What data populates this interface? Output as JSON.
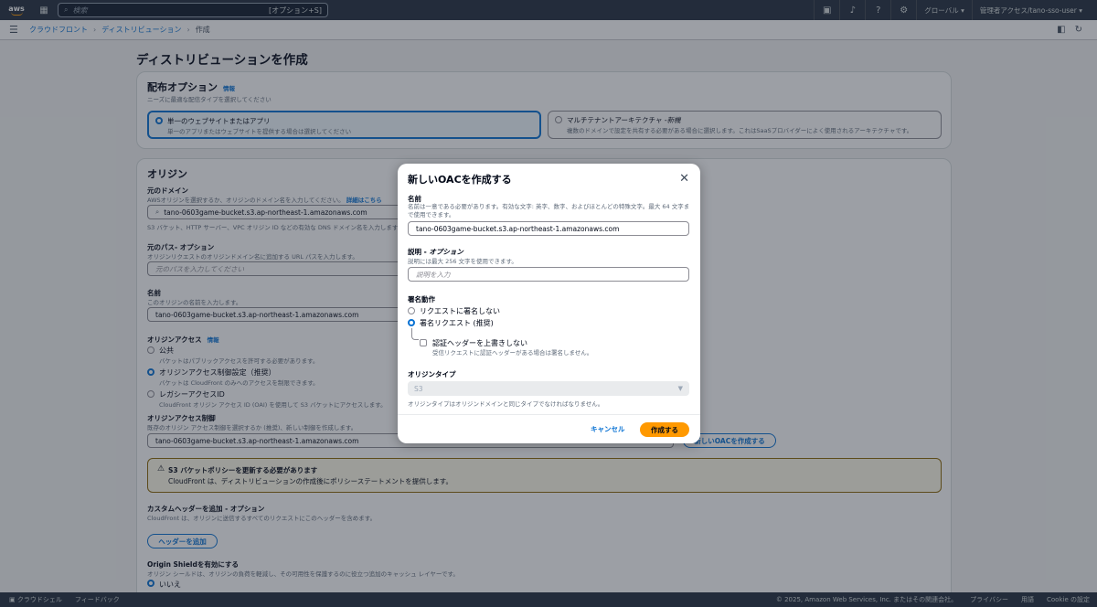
{
  "topnav": {
    "logo": "aws",
    "search_placeholder": "検索",
    "search_shortcut": "[オプション+S]",
    "region": "グローバル ▾",
    "account": "管理者アクセス/tano-sso-user ▾",
    "icons": [
      "cloudshell-icon",
      "bell-icon",
      "help-icon",
      "gear-icon"
    ]
  },
  "breadcrumb": {
    "items": [
      "クラウドフロント",
      "ディストリビューション"
    ],
    "current": "作成"
  },
  "page": {
    "title": "ディストリビューションを作成"
  },
  "distribution": {
    "heading": "配布オプション",
    "info": "情報",
    "desc": "ニーズに最適な配信タイプを選択してください",
    "opt1_title": "単一のウェブサイトまたはアプリ",
    "opt1_desc": "単一のアプリまたはウェブサイトを提供する場合は選択してください",
    "opt2_title": "マルチテナントアーキテクチャ -",
    "opt2_new": "新機",
    "opt2_desc": "複数のドメインで設定を共有する必要がある場合に選択します。これはSaaSプロバイダーによく使用されるアーキテクチャです。"
  },
  "origin": {
    "heading": "オリジン",
    "domain_label": "元のドメイン",
    "domain_desc": "AWSオリジンを選択するか、オリジンのドメイン名を入力してください。",
    "learn_more": "詳細はこちら",
    "domain_value": "tano-0603game-bucket.s3.ap-northeast-1.amazonaws.com",
    "domain_hint": "S3 バケット、HTTP サーバー、VPC オリジン ID などの有効な DNS ドメイン名を入力します。",
    "path_label": "元のパス- オプション",
    "path_desc": "オリジンリクエストのオリジンドメイン名に追加する URL パスを入力します。",
    "path_placeholder": "元のパスを入力してください",
    "name_label": "名前",
    "name_desc": "このオリジンの名前を入力します。",
    "name_value": "tano-0603game-bucket.s3.ap-northeast-1.amazonaws.com",
    "access_label": "オリジンアクセス",
    "access_info": "情報",
    "acc_public": "公共",
    "acc_public_desc": "バケットはパブリックアクセスを許可する必要があります。",
    "acc_oac": "オリジンアクセス制御設定（推奨）",
    "acc_oac_desc": "バケットは CloudFront のみへのアクセスを制限できます。",
    "acc_legacy": "レガシーアクセスID",
    "acc_legacy_desc": "CloudFront オリジン アクセス ID (OAI) を使用して S3 バケットにアクセスします。",
    "control_label": "オリジンアクセス制御",
    "control_desc": "既存のオリジン アクセス制御を選択するか (推奨)、新しい制御を作成します。",
    "control_value": "tano-0603game-bucket.s3.ap-northeast-1.amazonaws.com",
    "create_oac_btn": "新しいOACを作成する",
    "warn_title": "S3 バケットポリシーを更新する必要があります",
    "warn_body": "CloudFront は、ディストリビューションの作成後にポリシーステートメントを提供します。",
    "custom_hdr_label": "カスタムヘッダーを追加 - オプション",
    "custom_hdr_desc": "CloudFront は、オリジンに送信するすべてのリクエストにこのヘッダーを含めます。",
    "add_header_btn": "ヘッダーを追加",
    "shield_label": "Origin Shieldを有効にする",
    "shield_desc": "オリジン シールドは、オリジンの負荷を軽減し、その可用性を保護するのに役立つ追加のキャッシュ レイヤーです。",
    "shield_no": "いいえ"
  },
  "modal": {
    "title": "新しいOACを作成する",
    "name_label": "名前",
    "name_desc": "名前は一意である必要があります。有効な文字: 英字、数字、およびほとんどの特殊文字。最大 64 文字まで使用できます。",
    "name_value": "tano-0603game-bucket.s3.ap-northeast-1.amazonaws.com",
    "desc_label": "説明 -",
    "desc_optional": "オプション",
    "desc_desc": "説明には最大 256 文字を使用できます。",
    "desc_placeholder": "説明を入力",
    "sign_label": "署名動作",
    "sign_no": "リクエストに署名しない",
    "sign_yes": "署名リクエスト (推奨)",
    "no_override": "認証ヘッダーを上書きしない",
    "no_override_desc": "受信リクエストに認証ヘッダーがある場合は署名しません。",
    "origin_type_label": "オリジンタイプ",
    "origin_type_value": "S3",
    "origin_type_hint": "オリジンタイプはオリジンドメインと同じタイプでなければなりません。",
    "cancel": "キャンセル",
    "create": "作成する"
  },
  "footer": {
    "cloudshell": "クラウドシェル",
    "feedback": "フィードバック",
    "copyright": "© 2025, Amazon Web Services, Inc. またはその関連会社。",
    "privacy": "プライバシー",
    "terms": "用語",
    "cookie": "Cookie の設定"
  }
}
